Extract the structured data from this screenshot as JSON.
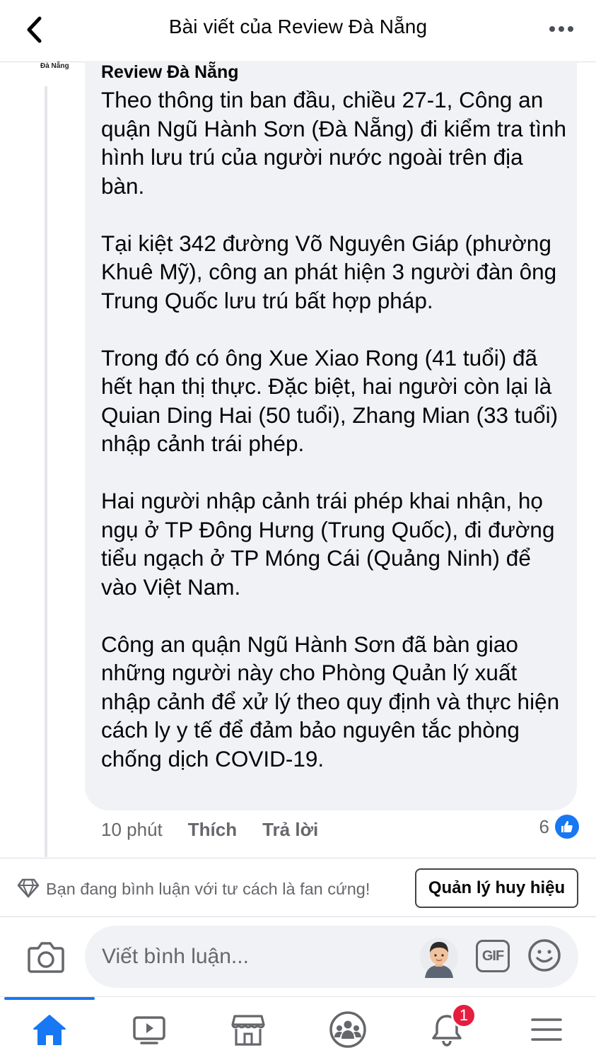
{
  "header": {
    "title": "Bài viết của Review Đà Nẵng"
  },
  "comment": {
    "avatar_label": "Đà Nẵng",
    "author": "Review Đà Nẵng",
    "paragraphs": [
      "Theo thông tin ban đầu, chiều 27-1, Công an quận Ngũ Hành Sơn (Đà Nẵng) đi kiểm tra tình hình lưu trú của người nước ngoài trên địa bàn.",
      "Tại kiệt 342 đường Võ Nguyên Giáp (phường Khuê Mỹ), công an phát hiện 3 người đàn ông Trung Quốc lưu trú bất hợp pháp.",
      "Trong đó có ông Xue Xiao Rong (41 tuổi) đã hết hạn thị thực. Đặc biệt, hai người còn lại là Quian Ding Hai (50 tuổi), Zhang Mian (33 tuổi) nhập cảnh trái phép.",
      "Hai người nhập cảnh trái phép khai nhận, họ ngụ ở TP Đông Hưng (Trung Quốc), đi đường tiểu ngạch ở TP Móng Cái (Quảng Ninh) để vào Việt Nam.",
      "Công an quận Ngũ Hành Sơn đã bàn giao những người này cho Phòng Quản lý xuất nhập cảnh để xử lý theo quy định và thực hiện cách ly y tế để đảm bảo nguyên tắc phòng chống dịch COVID-19."
    ],
    "time": "10 phút",
    "like_label": "Thích",
    "reply_label": "Trả lời",
    "reaction_count": "6"
  },
  "fan_bar": {
    "text": "Bạn đang bình luận với tư cách là fan cứng!",
    "button_label": "Quản lý huy hiệu"
  },
  "composer": {
    "placeholder": "Viết bình luận...",
    "gif_label": "GIF"
  },
  "bottom_nav": {
    "notification_count": "1",
    "items": [
      "home-icon",
      "watch-icon",
      "marketplace-icon",
      "groups-icon",
      "notifications-icon",
      "menu-icon"
    ]
  },
  "colors": {
    "accent": "#1877f2",
    "bubble": "#f0f2f5",
    "secondary_text": "#65676b",
    "badge_red": "#e41e3f"
  }
}
